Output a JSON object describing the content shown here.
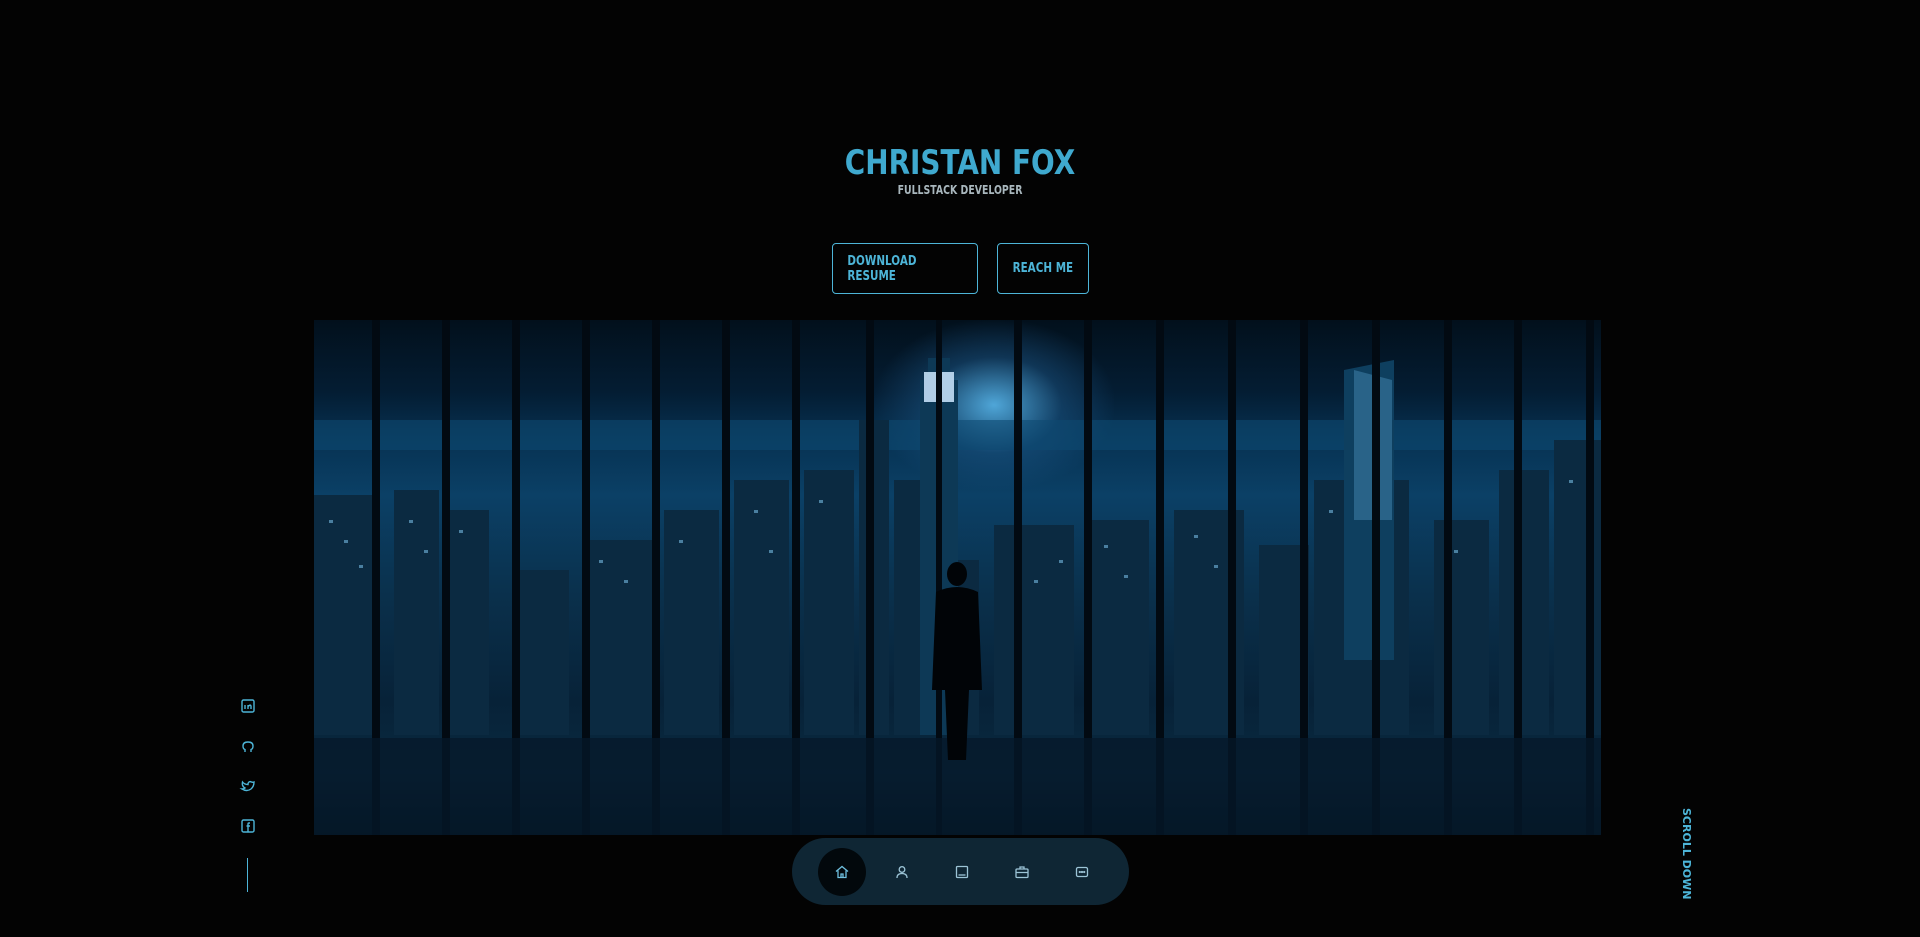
{
  "hero": {
    "name": "CHRISTAN FOX",
    "role": "FULLSTACK DEVELOPER",
    "buttons": {
      "download": "DOWNLOAD RESUME",
      "reach": "REACH ME"
    }
  },
  "social": {
    "icons": [
      "linkedin-icon",
      "github-icon",
      "twitter-icon",
      "facebook-icon"
    ]
  },
  "scroll_label": "SCROLL DOWN",
  "nav": {
    "items": [
      "home-icon",
      "user-icon",
      "book-icon",
      "briefcase-icon",
      "message-icon"
    ],
    "active": "home-icon"
  },
  "colors": {
    "accent": "#4db5d8",
    "background": "#030303",
    "nav_bg": "#0f2634"
  }
}
